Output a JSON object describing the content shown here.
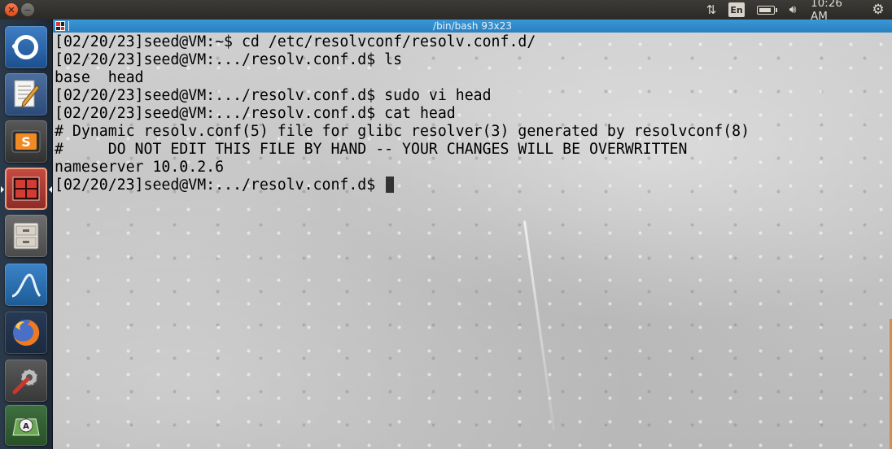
{
  "top_panel": {
    "language_indicator": "En",
    "clock": "10:26 AM",
    "icons": [
      "close-icon",
      "minimize-icon",
      "network-icon",
      "battery-icon",
      "volume-icon",
      "gear-icon"
    ]
  },
  "launcher": {
    "items": [
      {
        "name": "ubuntu-dash",
        "icon": "ubuntu-logo-icon"
      },
      {
        "name": "text-editor",
        "icon": "text-editor-icon"
      },
      {
        "name": "sublime-text",
        "icon": "sublime-text-icon"
      },
      {
        "name": "terminal",
        "icon": "terminal-icon"
      },
      {
        "name": "files",
        "icon": "file-cabinet-icon"
      },
      {
        "name": "wireshark",
        "icon": "wireshark-fin-icon"
      },
      {
        "name": "firefox",
        "icon": "firefox-icon"
      },
      {
        "name": "system-settings",
        "icon": "wrench-gear-icon"
      },
      {
        "name": "software-updater",
        "icon": "software-updater-icon"
      }
    ]
  },
  "terminal": {
    "title": "/bin/bash 93x23",
    "lines": [
      "[02/20/23]seed@VM:~$ cd /etc/resolvconf/resolv.conf.d/",
      "[02/20/23]seed@VM:.../resolv.conf.d$ ls",
      "base  head",
      "[02/20/23]seed@VM:.../resolv.conf.d$ sudo vi head",
      "[02/20/23]seed@VM:.../resolv.conf.d$ cat head",
      "# Dynamic resolv.conf(5) file for glibc resolver(3) generated by resolvconf(8)",
      "#     DO NOT EDIT THIS FILE BY HAND -- YOUR CHANGES WILL BE OVERWRITTEN",
      "nameserver 10.0.2.6",
      "[02/20/23]seed@VM:.../resolv.conf.d$ "
    ]
  }
}
